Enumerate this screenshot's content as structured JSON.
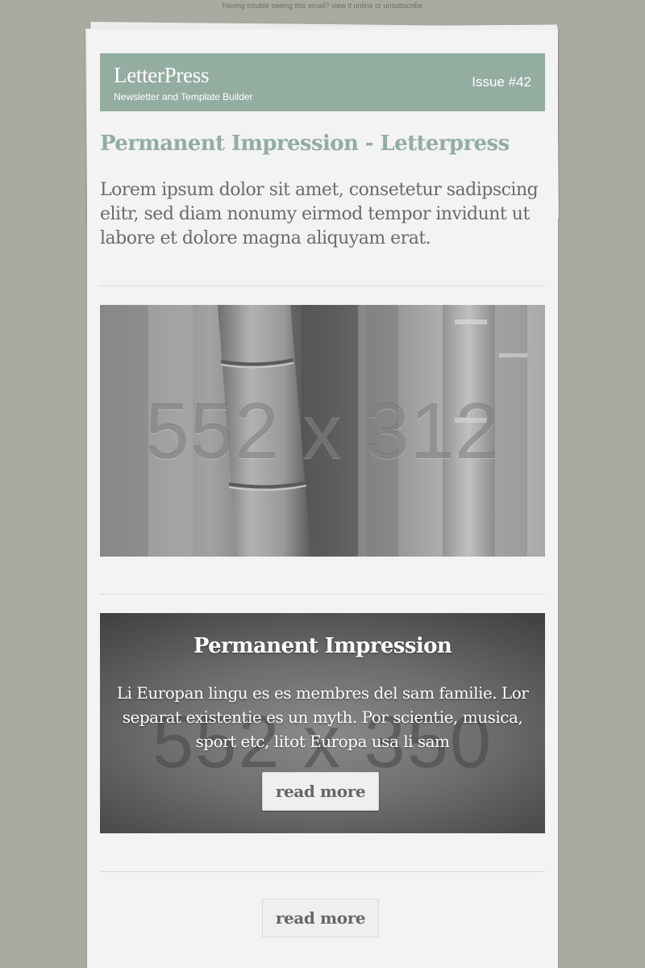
{
  "preheader": {
    "text": "Having trouble seeing this email? view it online or unsubscribe"
  },
  "header": {
    "brand": "LetterPress",
    "tagline": "Newsletter and Template Builder",
    "issue": "Issue #42"
  },
  "article": {
    "title": "Permanent Impression - Letterpress",
    "intro": "Lorem ipsum dolor sit amet, consetetur sadipscing elitr, sed diam nonumy eirmod tempor invidunt ut labore et dolore magna aliquyam erat."
  },
  "hero_image": {
    "placeholder_label": "552 x 312"
  },
  "promo": {
    "placeholder_label": "552 x 350",
    "title": "Permanent Impression",
    "text": "Li Europan lingu es es membres del sam familie. Lor separat existentie es un myth. Por scientie, musica, sport etc, litot Europa usa li sam",
    "button_label": "read more"
  },
  "footer_button": {
    "label": "read more"
  },
  "colors": {
    "background": "#a9aaa1",
    "page": "#f3f3f3",
    "accent": "#93aea0",
    "body_text": "#6b6b6b"
  }
}
